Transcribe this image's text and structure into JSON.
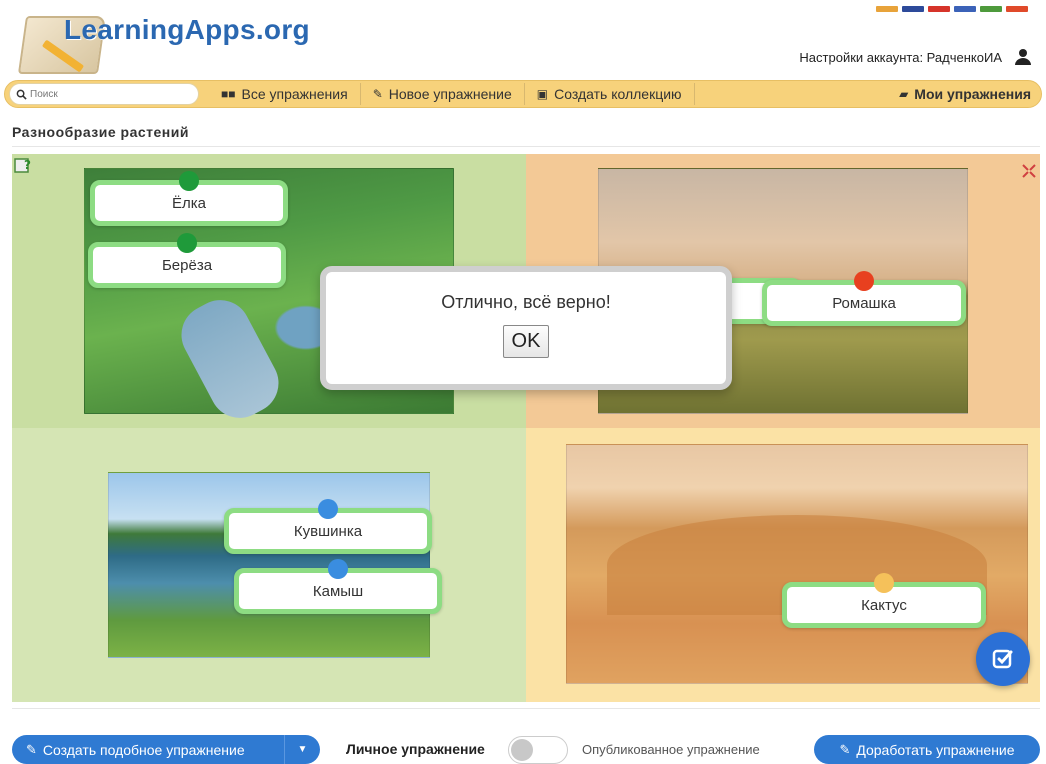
{
  "header": {
    "logo_text": "LearningApps.org",
    "account_label": "Настройки аккаунта: РадченкоИА"
  },
  "nav": {
    "search_placeholder": "Поиск",
    "all_exercises": "Все упражнения",
    "new_exercise": "Новое упражнение",
    "create_collection": "Создать коллекцию",
    "my_exercises": "Мои упражнения"
  },
  "page": {
    "title": "Разнообразие растений"
  },
  "cards": {
    "elka": "Ёлка",
    "bereza": "Берёза",
    "romashka": "Ромашка",
    "kuvshinka": "Кувшинка",
    "kamysh": "Камыш",
    "kaktus": "Кактус"
  },
  "modal": {
    "message": "Отлично, всё верно!",
    "ok_label": "OK"
  },
  "footer": {
    "create_similar": "Создать подобное упражнение",
    "private_label": "Личное упражнение",
    "published_label": "Опубликованное упражнение",
    "improve": "Доработать упражнение"
  },
  "colors": {
    "nav_bg": "#f7d27b",
    "card_border": "#8ddc83",
    "primary_button": "#2f7ad2",
    "pin_green": "#1f9a3a",
    "pin_red": "#e8401f",
    "pin_blue": "#3a8de0",
    "pin_yellow": "#f5c15a"
  }
}
